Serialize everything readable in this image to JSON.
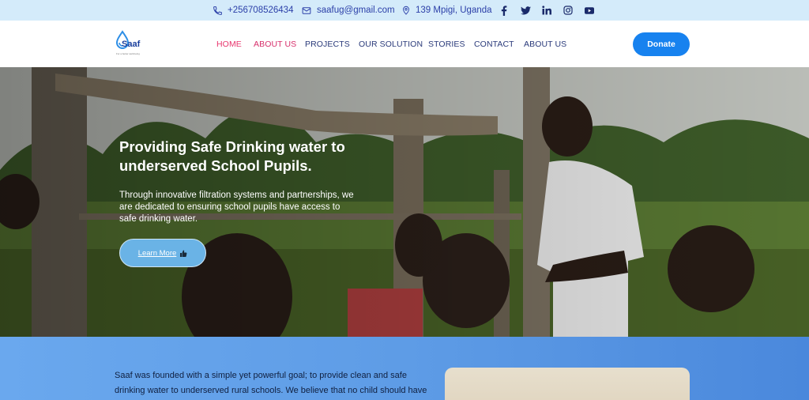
{
  "topbar": {
    "phone": "+256708526434",
    "email": "saafug@gmail.com",
    "location": "139 Mpigi, Uganda",
    "social": [
      "facebook-icon",
      "twitter-icon",
      "linkedin-icon",
      "instagram-icon",
      "youtube-icon"
    ]
  },
  "header": {
    "logo_text": "Saaf",
    "logo_tagline": "For a better well-being",
    "nav": [
      {
        "label": "HOME"
      },
      {
        "label": "ABOUT US"
      },
      {
        "label": "PROJECTS"
      },
      {
        "label": "OUR SOLUTION"
      },
      {
        "label": "STORIES"
      },
      {
        "label": "CONTACT"
      },
      {
        "label": "ABOUT US"
      }
    ],
    "donate_label": "Donate"
  },
  "hero": {
    "title": "Providing Safe Drinking water to underserved School Pupils.",
    "text": "Through innovative filtration systems and partnerships, we are dedicated to ensuring school pupils have access to safe drinking water.",
    "button_label": "Learn More"
  },
  "about": {
    "text": "Saaf was founded with a simple yet powerful goal; to provide clean and safe drinking water to underserved rural schools. We believe that no child should have"
  },
  "colors": {
    "accent": "#1782ef",
    "nav_active": "#e8356d",
    "topbar_bg": "#d4ebfa",
    "about_bg": "#5e9ce6"
  }
}
